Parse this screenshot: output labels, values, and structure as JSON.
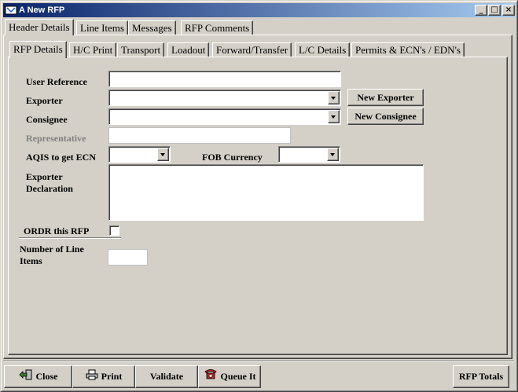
{
  "window": {
    "title": "A New RFP",
    "controls": {
      "minimize": "_",
      "maximize": "□",
      "close": "×"
    }
  },
  "main_tabs": [
    {
      "label": "Header Details",
      "active": true
    },
    {
      "label": "Line Items"
    },
    {
      "label": "Messages"
    },
    {
      "label": "RFP Comments"
    }
  ],
  "sub_tabs": [
    {
      "label": "RFP Details",
      "active": true
    },
    {
      "label": "H/C Print"
    },
    {
      "label": "Transport"
    },
    {
      "label": "Loadout"
    },
    {
      "label": "Forward/Transfer"
    },
    {
      "label": "L/C Details"
    },
    {
      "label": "Permits & ECN's / EDN's"
    }
  ],
  "form": {
    "user_reference": {
      "label": "User Reference",
      "value": ""
    },
    "exporter": {
      "label": "Exporter",
      "value": ""
    },
    "consignee": {
      "label": "Consignee",
      "value": ""
    },
    "representative": {
      "label": "Representative",
      "value": ""
    },
    "aqis": {
      "label": "AQIS to get ECN",
      "value": ""
    },
    "fob_currency": {
      "label": "FOB Currency",
      "value": ""
    },
    "exporter_declaration": {
      "label_line1": "Exporter",
      "label_line2": "Declaration",
      "value": ""
    },
    "ordr": {
      "label": "ORDR this RFP",
      "checked": false
    },
    "line_items": {
      "label_line1": "Number of Line",
      "label_line2": "Items",
      "value": ""
    }
  },
  "buttons": {
    "new_exporter": "New Exporter",
    "new_consignee": "New Consignee",
    "close": "Close",
    "print": "Print",
    "validate": "Validate",
    "queue_it": "Queue It",
    "rfp_totals": "RFP Totals"
  },
  "icons": {
    "app": "app-icon",
    "close": "exit-icon",
    "print": "printer-icon",
    "queue": "telephone-icon"
  }
}
